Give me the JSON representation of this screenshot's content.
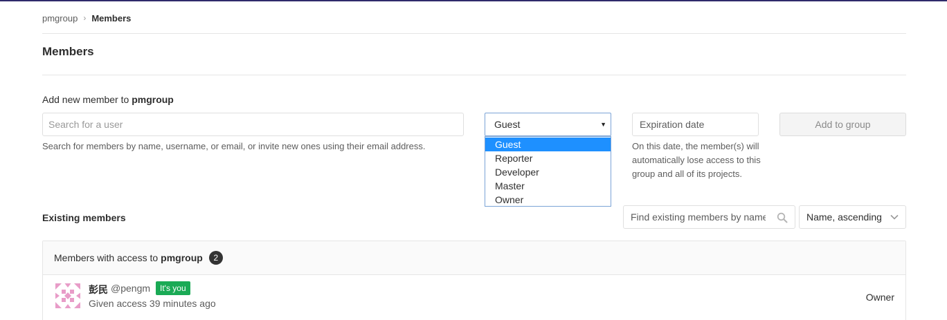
{
  "breadcrumb": {
    "group": "pmgroup",
    "current": "Members"
  },
  "page": {
    "title": "Members"
  },
  "add_member": {
    "label_prefix": "Add new member to",
    "group_name": "pmgroup",
    "search_placeholder": "Search for a user",
    "search_help": "Search for members by name, username, or email, or invite new ones using their email address.",
    "role_selected": "Guest",
    "role_options": [
      "Guest",
      "Reporter",
      "Developer",
      "Master",
      "Owner"
    ],
    "expiration_placeholder": "Expiration date",
    "expiration_help": "On this date, the member(s) will automatically lose access to this group and all of its projects.",
    "add_button": "Add to group"
  },
  "existing": {
    "title": "Existing members",
    "find_placeholder": "Find existing members by name",
    "sort_selected": "Name, ascending"
  },
  "members_panel": {
    "header_prefix": "Members with access to",
    "group_name": "pmgroup",
    "count": "2",
    "members": [
      {
        "name": "彭民",
        "username": "@pengm",
        "badge": "It's you",
        "access": "Given access 39 minutes ago",
        "role": "Owner"
      }
    ]
  },
  "colors": {
    "accent_blue": "#1e90ff",
    "badge_green": "#1aaa55",
    "avatar_pink": "#e89cc8",
    "top_border": "#2f2a6b"
  }
}
